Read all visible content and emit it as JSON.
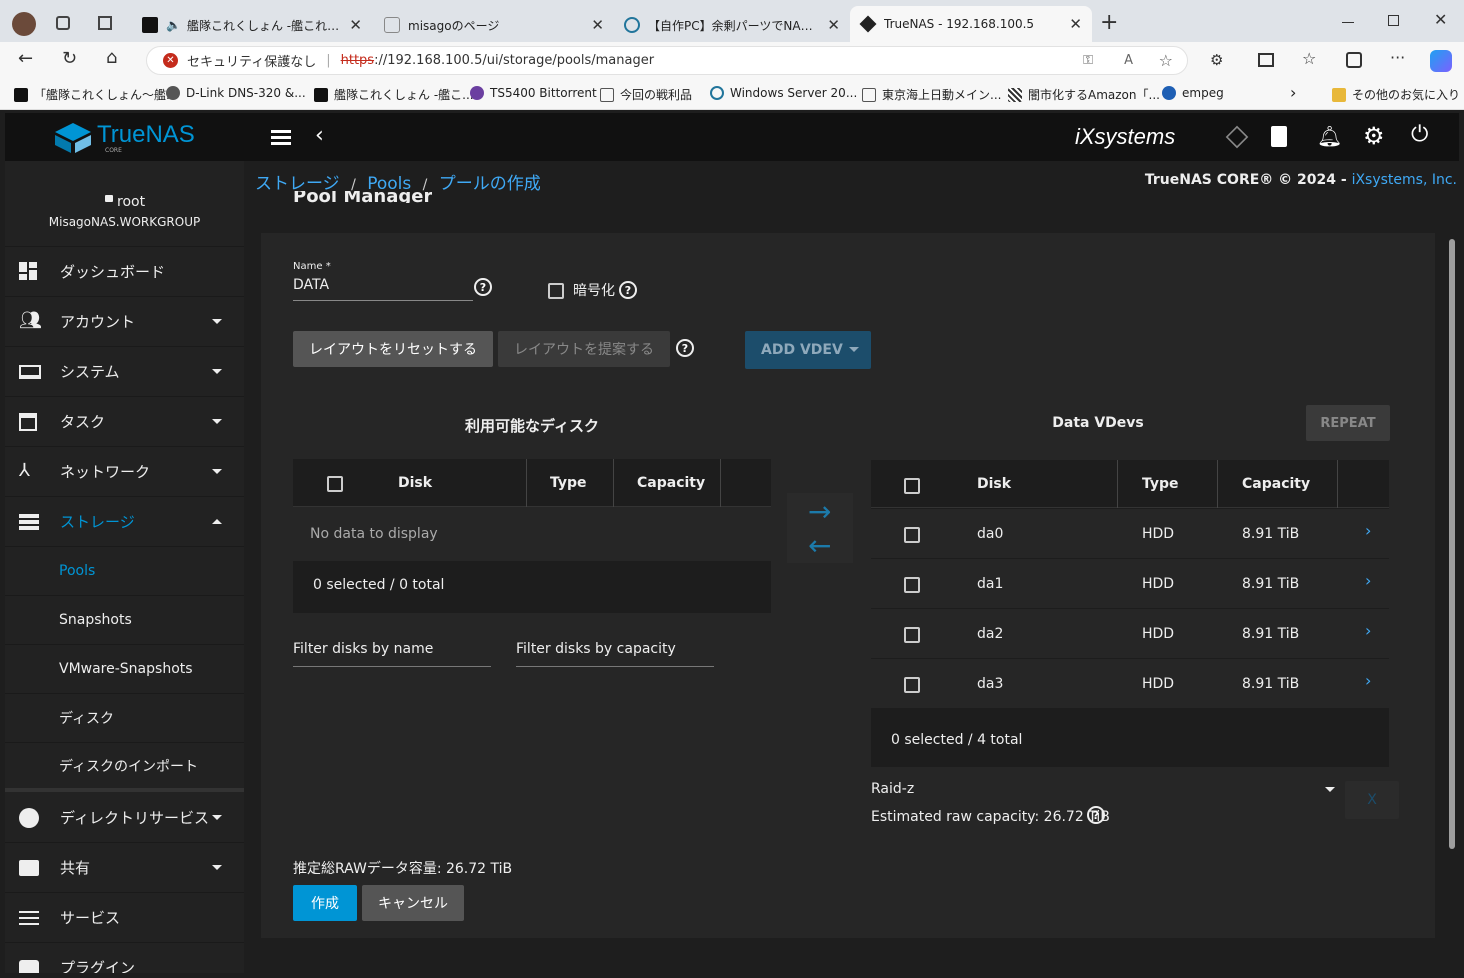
{
  "browser": {
    "tabs": [
      {
        "title": "艦隊これくしょん -艦これ- - オン",
        "active": false
      },
      {
        "title": "misagoのページ",
        "active": false
      },
      {
        "title": "【自作PC】余剰パーツでNASを組み立",
        "active": false
      },
      {
        "title": "TrueNAS - 192.168.100.5",
        "active": true
      }
    ],
    "security_label": "セキュリティ保護なし",
    "url_scheme": "https",
    "url_rest": "://192.168.100.5/ui/storage/pools/manager",
    "bookmarks": [
      "「艦隊これくしょん～艦...",
      "D-Link DNS-320 &...",
      "艦隊これくしょん -艦こ...",
      "TS5400 Bittorrent",
      "今回の戦利品",
      "Windows Server 20...",
      "東京海上日動メイン...",
      "闇市化するAmazon「...",
      "empeg"
    ],
    "other_favorites": "その他のお気に入り"
  },
  "app": {
    "logo_text": "TrueNAS",
    "logo_sub": "CORE",
    "vendor_logo": "iXsystems",
    "copyright": "TrueNAS CORE® © 2024 - ",
    "copyright_link": "iXsystems, Inc."
  },
  "user": {
    "name": "root",
    "host": "MisagoNAS.WORKGROUP"
  },
  "sidebar": {
    "items": [
      {
        "label": "ダッシュボード"
      },
      {
        "label": "アカウント"
      },
      {
        "label": "システム"
      },
      {
        "label": "タスク"
      },
      {
        "label": "ネットワーク"
      },
      {
        "label": "ストレージ"
      },
      {
        "label": "ディレクトリサービス"
      },
      {
        "label": "共有"
      },
      {
        "label": "サービス"
      },
      {
        "label": "プラグイン"
      }
    ],
    "storage_sub": [
      "Pools",
      "Snapshots",
      "VMware-Snapshots",
      "ディスク",
      "ディスクのインポート"
    ]
  },
  "breadcrumb": [
    "ストレージ",
    "Pools",
    "プールの作成"
  ],
  "pool": {
    "title": "Pool Manager",
    "name_label": "Name",
    "name_value": "DATA",
    "encrypt_label": "暗号化",
    "reset_btn": "レイアウトをリセットする",
    "suggest_btn": "レイアウトを提案する",
    "add_vdev": "ADD VDEV",
    "available_title": "利用可能なディスク",
    "columns": [
      "Disk",
      "Type",
      "Capacity"
    ],
    "no_data": "No data to display",
    "available_footer": "0 selected / 0 total",
    "filter_name": "Filter disks by name",
    "filter_capacity": "Filter disks by capacity",
    "vdev_title": "Data VDevs",
    "repeat_btn": "REPEAT",
    "vdev_disks": [
      {
        "disk": "da0",
        "type": "HDD",
        "capacity": "8.91 TiB"
      },
      {
        "disk": "da1",
        "type": "HDD",
        "capacity": "8.91 TiB"
      },
      {
        "disk": "da2",
        "type": "HDD",
        "capacity": "8.91 TiB"
      },
      {
        "disk": "da3",
        "type": "HDD",
        "capacity": "8.91 TiB"
      }
    ],
    "vdev_footer": "0 selected / 4 total",
    "raid": "Raid-z",
    "estimated": "Estimated raw capacity: 26.72 TiB",
    "total_raw": "推定総RAWデータ容量: 26.72 TiB",
    "create_btn": "作成",
    "cancel_btn": "キャンセル",
    "remove_x": "X"
  },
  "colors": {
    "accent": "#0095d5",
    "link": "#3fa9f5",
    "header": "#111111",
    "sidebar": "#222222"
  }
}
